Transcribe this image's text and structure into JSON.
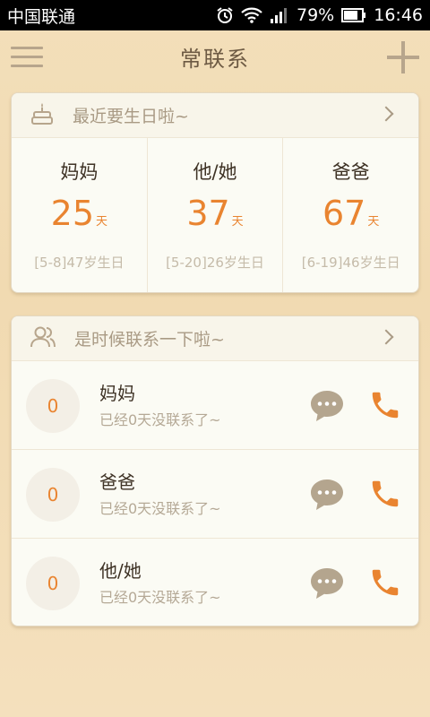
{
  "status": {
    "carrier": "中国联通",
    "battery": "79%",
    "time": "16:46"
  },
  "header": {
    "title": "常联系"
  },
  "birthday": {
    "title": "最近要生日啦~",
    "items": [
      {
        "name": "妈妈",
        "days": "25",
        "unit": "天",
        "info": "[5-8]47岁生日"
      },
      {
        "name": "他/她",
        "days": "37",
        "unit": "天",
        "info": "[5-20]26岁生日"
      },
      {
        "name": "爸爸",
        "days": "67",
        "unit": "天",
        "info": "[6-19]46岁生日"
      }
    ]
  },
  "contact": {
    "title": "是时候联系一下啦~",
    "items": [
      {
        "count": "0",
        "name": "妈妈",
        "status": "已经0天没联系了~"
      },
      {
        "count": "0",
        "name": "爸爸",
        "status": "已经0天没联系了~"
      },
      {
        "count": "0",
        "name": "他/她",
        "status": "已经0天没联系了~"
      }
    ]
  },
  "colors": {
    "accent": "#e98430",
    "muted": "#b7a58c",
    "bubble": "#b4a58e"
  }
}
